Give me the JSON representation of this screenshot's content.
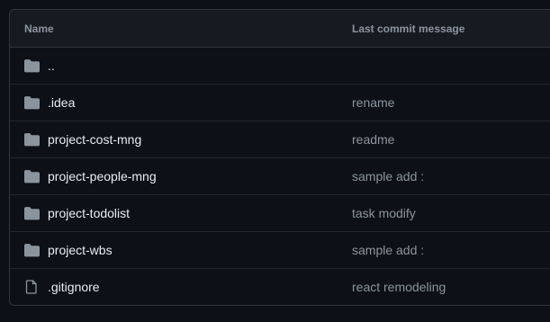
{
  "table": {
    "headers": {
      "name": "Name",
      "message": "Last commit message"
    },
    "rows": [
      {
        "name": "..",
        "message": "",
        "icon": "folder-icon"
      },
      {
        "name": ".idea",
        "message": "rename",
        "icon": "folder-icon"
      },
      {
        "name": "project-cost-mng",
        "message": "readme",
        "icon": "folder-icon"
      },
      {
        "name": "project-people-mng",
        "message": "sample add :",
        "icon": "folder-icon"
      },
      {
        "name": "project-todolist",
        "message": "task modify",
        "icon": "folder-icon"
      },
      {
        "name": "project-wbs",
        "message": "sample add :",
        "icon": "folder-icon"
      },
      {
        "name": ".gitignore",
        "message": "react remodeling",
        "icon": "file-icon"
      }
    ]
  },
  "colors": {
    "background": "#0d1117",
    "header_background": "#161b22",
    "border": "#30363d",
    "icon": "#8b949e",
    "primary_text": "#e6edf3",
    "secondary_text": "#8b949e"
  }
}
